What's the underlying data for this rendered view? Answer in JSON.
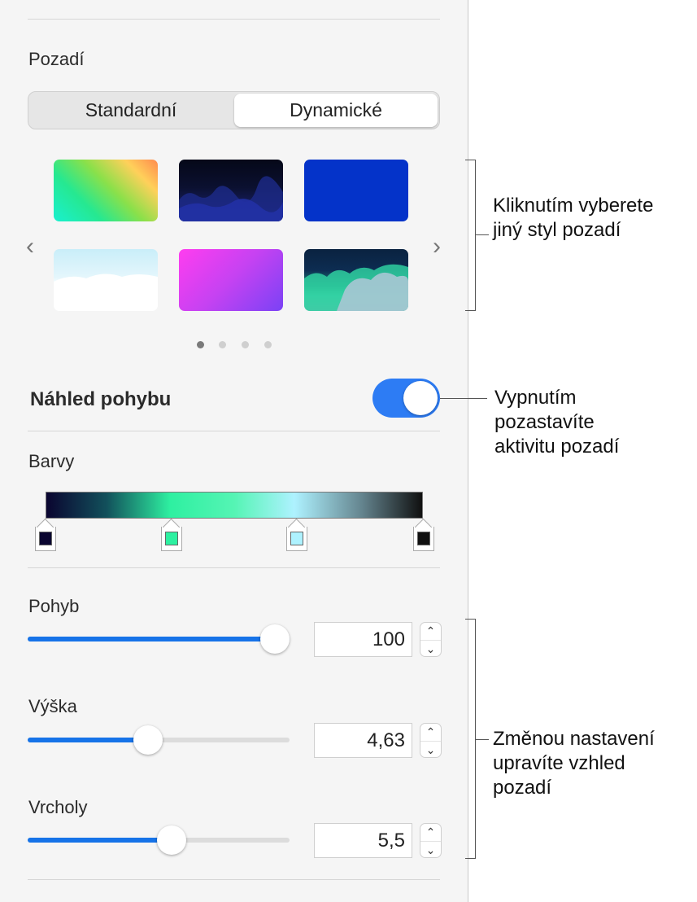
{
  "background": {
    "title": "Pozadí",
    "tabs": [
      "Standardní",
      "Dynamické"
    ],
    "selected_tab": "Dynamické",
    "thumbnails": [
      "rainbow-gradient",
      "dark-mountains",
      "solid-blue",
      "white-clouds",
      "magenta-purple-gradient",
      "teal-clouds"
    ],
    "prev_icon": "‹",
    "next_icon": "›",
    "page_count": 4,
    "current_page": 1
  },
  "motion_preview": {
    "label": "Náhled pohybu",
    "enabled": true
  },
  "colors": {
    "label": "Barvy",
    "stops": [
      "#0a0530",
      "#2ef0a1",
      "#aef2ff",
      "#101010"
    ]
  },
  "sliders": {
    "motion": {
      "label": "Pohyb",
      "value": "100",
      "fraction": 1.0
    },
    "height": {
      "label": "Výška",
      "value": "4,63",
      "fraction": 0.46
    },
    "peaks": {
      "label": "Vrcholy",
      "value": "5,5",
      "fraction": 0.55
    }
  },
  "stepper_icons": {
    "up": "⌃",
    "down": "⌄"
  },
  "callouts": {
    "styles": [
      "Kliknutím vyberete",
      "jiný styl pozadí"
    ],
    "toggle": [
      "Vypnutím",
      "pozastavíte",
      "aktivitu pozadí"
    ],
    "settings": [
      "Změnou nastavení",
      "upravíte vzhled",
      "pozadí"
    ]
  },
  "accent_color": "#2d7cf4"
}
